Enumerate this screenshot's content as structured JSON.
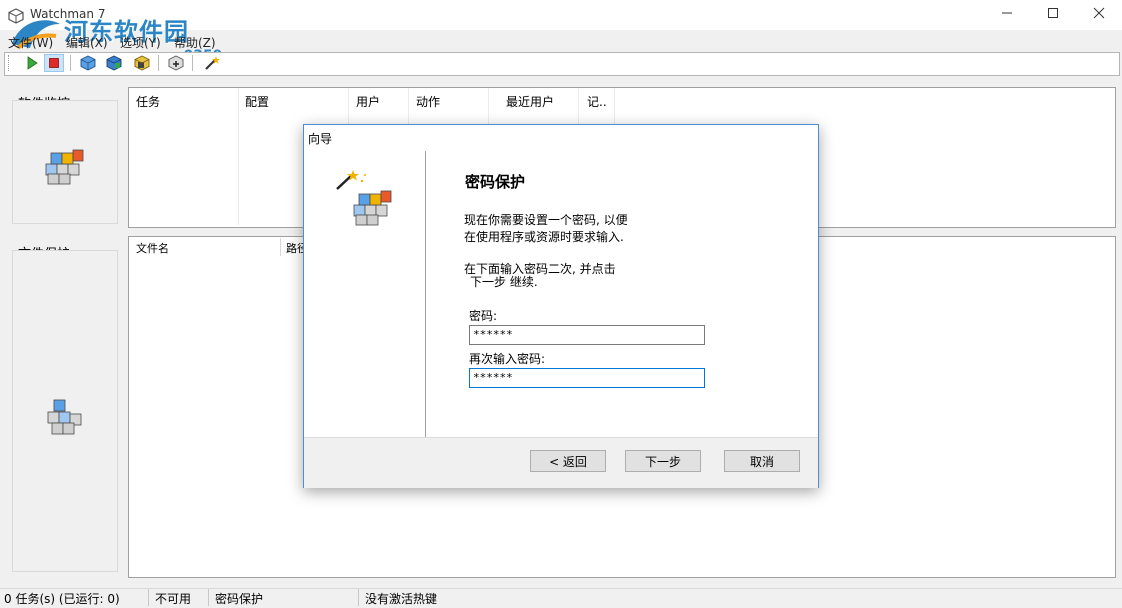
{
  "window": {
    "title": "Watchman 7"
  },
  "watermark": {
    "main": "河东软件园",
    "url": "www.pc0359.cn"
  },
  "menu": {
    "file": "文件(W)",
    "edit": "编辑(X)",
    "options": "选项(Y)",
    "help": "帮助(Z)"
  },
  "toolbar": {
    "icons": [
      "start-icon",
      "stop-icon",
      "cube-blue-icon",
      "cube-multi-icon",
      "cube-lock-icon",
      "add-icon",
      "wizard-wand-icon"
    ]
  },
  "sidebar": {
    "software_monitor": "软件监控",
    "file_protect": "文件保护"
  },
  "task_list": {
    "columns": [
      "任务",
      "配置",
      "用户",
      "动作",
      "最近用户",
      "记.."
    ]
  },
  "file_list": {
    "columns": [
      "文件名",
      "路径"
    ]
  },
  "wizard": {
    "title": "向导",
    "heading": "密码保护",
    "desc_line1": "现在你需要设置一个密码, 以便",
    "desc_line2": "在使用程序或资源时要求输入.",
    "instr_line1": "在下面输入密码二次,  并点击",
    "instr_line2": "下一步  继续.",
    "password_label": "密码:",
    "password_value": "******",
    "confirm_label": "再次输入密码:",
    "confirm_value": "******",
    "back_button": "< 返回",
    "next_button": "下一步",
    "cancel_button": "取消"
  },
  "status": {
    "tasks": "0 任务(s) (已运行: 0)",
    "availability": "不可用",
    "mode": "密码保护",
    "hotkey": "没有激活热键"
  },
  "colors": {
    "accent": "#4c8fcf",
    "watermark": "#2c86c6"
  }
}
